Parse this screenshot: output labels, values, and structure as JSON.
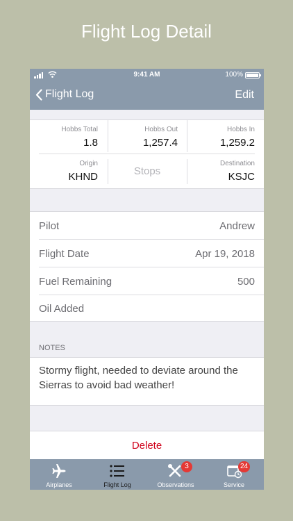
{
  "caption": "Flight Log Detail",
  "status_bar": {
    "time": "9:41 AM",
    "battery": "100%"
  },
  "nav": {
    "back_label": "Flight Log",
    "edit_label": "Edit"
  },
  "hobbs": {
    "total": {
      "label": "Hobbs Total",
      "value": "1.8"
    },
    "out": {
      "label": "Hobbs Out",
      "value": "1,257.4"
    },
    "in": {
      "label": "Hobbs In",
      "value": "1,259.2"
    },
    "origin": {
      "label": "Origin",
      "value": "KHND"
    },
    "stops_placeholder": "Stops",
    "destination": {
      "label": "Destination",
      "value": "KSJC"
    }
  },
  "details": [
    {
      "label": "Pilot",
      "value": "Andrew"
    },
    {
      "label": "Flight Date",
      "value": "Apr 19, 2018"
    },
    {
      "label": "Fuel Remaining",
      "value": "500"
    },
    {
      "label": "Oil Added",
      "value": ""
    }
  ],
  "notes": {
    "header": "NOTES",
    "text": "Stormy flight, needed to deviate around the Sierras to avoid bad weather!"
  },
  "delete_label": "Delete",
  "tabs": [
    {
      "label": "Airplanes",
      "icon": "airplane-icon",
      "badge": ""
    },
    {
      "label": "Flight Log",
      "icon": "list-icon",
      "badge": ""
    },
    {
      "label": "Observations",
      "icon": "wrench-icon",
      "badge": "3"
    },
    {
      "label": "Service",
      "icon": "calendar-clock-icon",
      "badge": "24"
    }
  ],
  "colors": {
    "bar": "#8a9aab",
    "delete": "#d0021b",
    "badge": "#e53935",
    "background": "#bcbfa9"
  }
}
